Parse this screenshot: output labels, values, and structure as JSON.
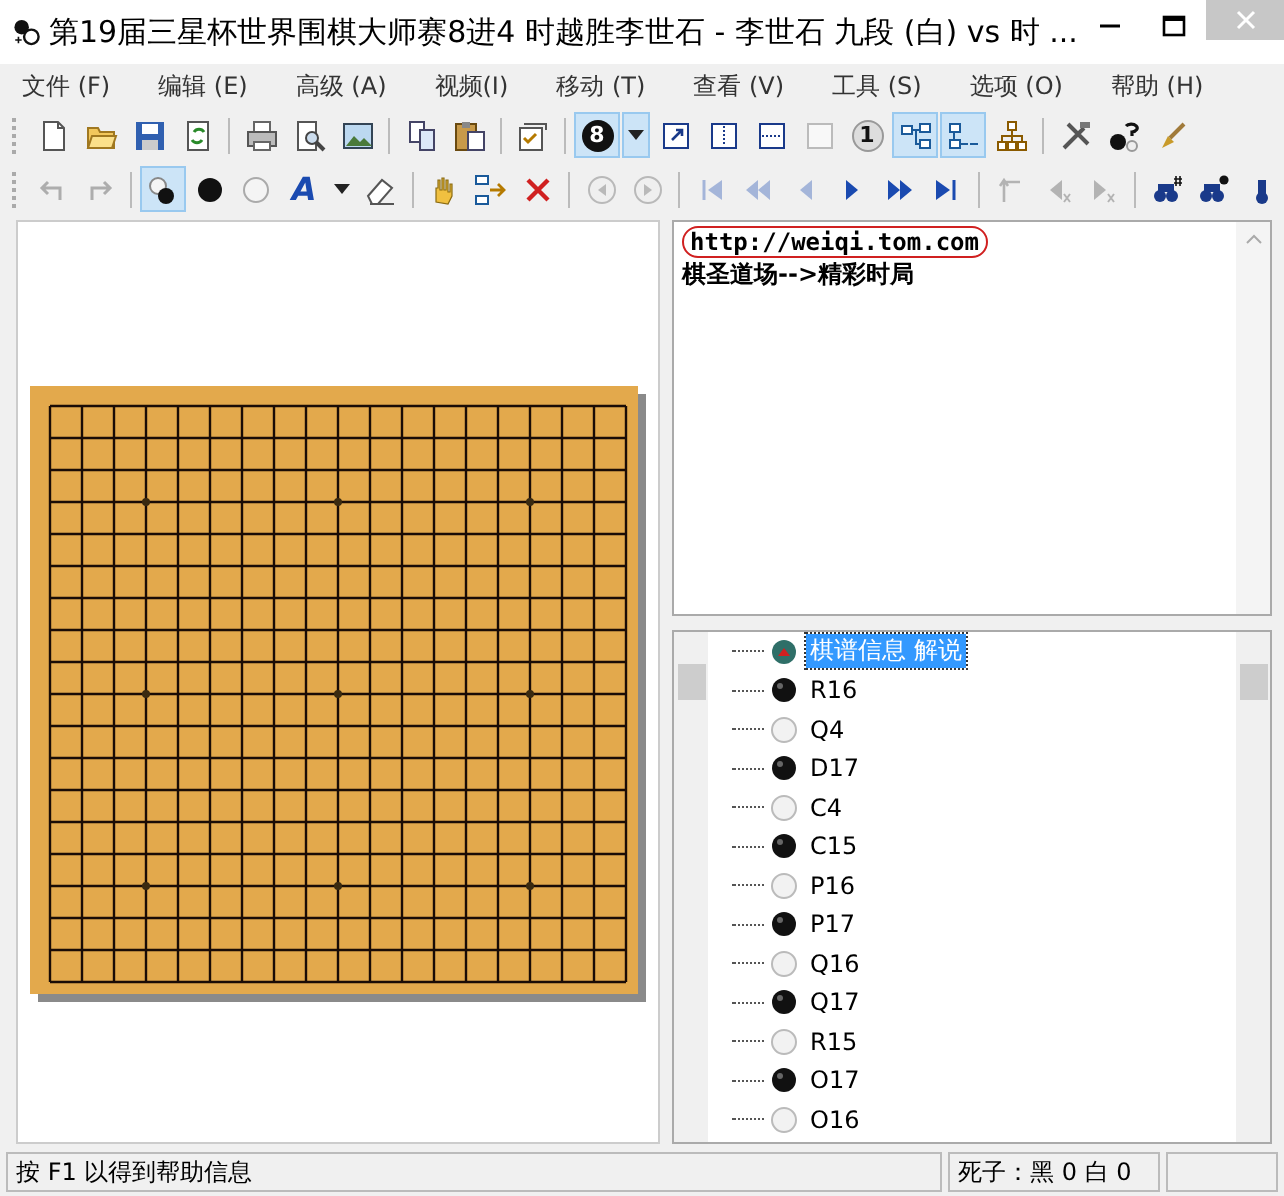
{
  "window": {
    "title": "第19届三星杯世界围棋大师赛8进4 时越胜李世石 - 李世石 九段 (白) vs 时  ..."
  },
  "menu": [
    "文件 (F)",
    "编辑 (E)",
    "高级 (A)",
    "视频(I)",
    "移动 (T)",
    "查看 (V)",
    "工具 (S)",
    "选项 (O)",
    "帮助 (H)"
  ],
  "toolbar_1": [
    {
      "kind": "new",
      "pressed": false,
      "disabled": false
    },
    {
      "kind": "open",
      "pressed": false,
      "disabled": false
    },
    {
      "kind": "save",
      "pressed": false,
      "disabled": false
    },
    {
      "kind": "refresh",
      "pressed": false,
      "disabled": false
    },
    {
      "kind": "separator"
    },
    {
      "kind": "print",
      "pressed": false,
      "disabled": false
    },
    {
      "kind": "preview",
      "pressed": false,
      "disabled": false
    },
    {
      "kind": "image",
      "pressed": false,
      "disabled": false
    },
    {
      "kind": "separator"
    },
    {
      "kind": "copy",
      "pressed": false,
      "disabled": false
    },
    {
      "kind": "paste",
      "pressed": false,
      "disabled": false
    },
    {
      "kind": "separator"
    },
    {
      "kind": "properties",
      "pressed": false,
      "disabled": false
    },
    {
      "kind": "separator"
    },
    {
      "kind": "numbered",
      "label": "8",
      "pressed": true,
      "disabled": false
    },
    {
      "kind": "dropdown",
      "pressed": true,
      "disabled": false
    },
    {
      "kind": "export",
      "pressed": false,
      "disabled": false
    },
    {
      "kind": "split-vertical",
      "pressed": false,
      "disabled": false
    },
    {
      "kind": "split-horizontal",
      "pressed": false,
      "disabled": false
    },
    {
      "kind": "blank",
      "pressed": false,
      "disabled": false
    },
    {
      "kind": "numbered-white",
      "label": "1",
      "pressed": false,
      "disabled": false
    },
    {
      "kind": "tree-horizontal",
      "pressed": true,
      "disabled": false
    },
    {
      "kind": "tree-compact",
      "pressed": true,
      "disabled": false
    },
    {
      "kind": "tree-org",
      "pressed": false,
      "disabled": false
    },
    {
      "kind": "separator"
    },
    {
      "kind": "tools",
      "pressed": false,
      "disabled": false
    },
    {
      "kind": "stone-question",
      "pressed": false,
      "disabled": false
    },
    {
      "kind": "brush",
      "pressed": false,
      "disabled": false
    }
  ],
  "toolbar_2": [
    {
      "kind": "undo",
      "pressed": false,
      "disabled": true
    },
    {
      "kind": "redo",
      "pressed": false,
      "disabled": true
    },
    {
      "kind": "separator"
    },
    {
      "kind": "stones",
      "pressed": true,
      "disabled": false
    },
    {
      "kind": "black-stone",
      "pressed": false,
      "disabled": false
    },
    {
      "kind": "white-stone",
      "pressed": false,
      "disabled": false
    },
    {
      "kind": "text",
      "label": "A",
      "pressed": false,
      "disabled": false
    },
    {
      "kind": "dropdown",
      "pressed": false,
      "disabled": false
    },
    {
      "kind": "eraser",
      "pressed": false,
      "disabled": false
    },
    {
      "kind": "separator"
    },
    {
      "kind": "hand",
      "pressed": false,
      "disabled": false
    },
    {
      "kind": "insert",
      "pressed": false,
      "disabled": false
    },
    {
      "kind": "delete",
      "pressed": false,
      "disabled": false
    },
    {
      "kind": "separator"
    },
    {
      "kind": "circle-left",
      "pressed": false,
      "disabled": true
    },
    {
      "kind": "circle-right",
      "pressed": false,
      "disabled": true
    },
    {
      "kind": "separator"
    },
    {
      "kind": "first",
      "pressed": false,
      "disabled": true
    },
    {
      "kind": "fast-back",
      "pressed": false,
      "disabled": true
    },
    {
      "kind": "back",
      "pressed": false,
      "disabled": true
    },
    {
      "kind": "forward",
      "pressed": false,
      "disabled": false
    },
    {
      "kind": "fast-forward",
      "pressed": false,
      "disabled": false
    },
    {
      "kind": "last",
      "pressed": false,
      "disabled": false
    },
    {
      "kind": "separator"
    },
    {
      "kind": "branch-up",
      "pressed": false,
      "disabled": true
    },
    {
      "kind": "branch-left",
      "pressed": false,
      "disabled": true
    },
    {
      "kind": "branch-right",
      "pressed": false,
      "disabled": true
    },
    {
      "kind": "separator"
    },
    {
      "kind": "find-hash",
      "pressed": false,
      "disabled": false
    },
    {
      "kind": "find-stone",
      "pressed": false,
      "disabled": false
    },
    {
      "kind": "find",
      "pressed": false,
      "disabled": false
    }
  ],
  "comment": {
    "link": "http://weiqi.tom.com",
    "link_circled": true,
    "text": "棋圣道场-->精彩时局"
  },
  "move_tree": [
    {
      "kind": "info",
      "label": "棋谱信息 解说",
      "selected": true
    },
    {
      "kind": "black",
      "label": "R16",
      "selected": false
    },
    {
      "kind": "white",
      "label": "Q4",
      "selected": false
    },
    {
      "kind": "black",
      "label": "D17",
      "selected": false
    },
    {
      "kind": "white",
      "label": "C4",
      "selected": false
    },
    {
      "kind": "black",
      "label": "C15",
      "selected": false
    },
    {
      "kind": "white",
      "label": "P16",
      "selected": false
    },
    {
      "kind": "black",
      "label": "P17",
      "selected": false
    },
    {
      "kind": "white",
      "label": "Q16",
      "selected": false
    },
    {
      "kind": "black",
      "label": "Q17",
      "selected": false
    },
    {
      "kind": "white",
      "label": "R15",
      "selected": false
    },
    {
      "kind": "black",
      "label": "O17",
      "selected": false
    },
    {
      "kind": "white",
      "label": "O16",
      "selected": false
    }
  ],
  "status_bar": {
    "help": "按 F1 以得到帮助信息",
    "captures": "死子：黑 0 白 0"
  }
}
